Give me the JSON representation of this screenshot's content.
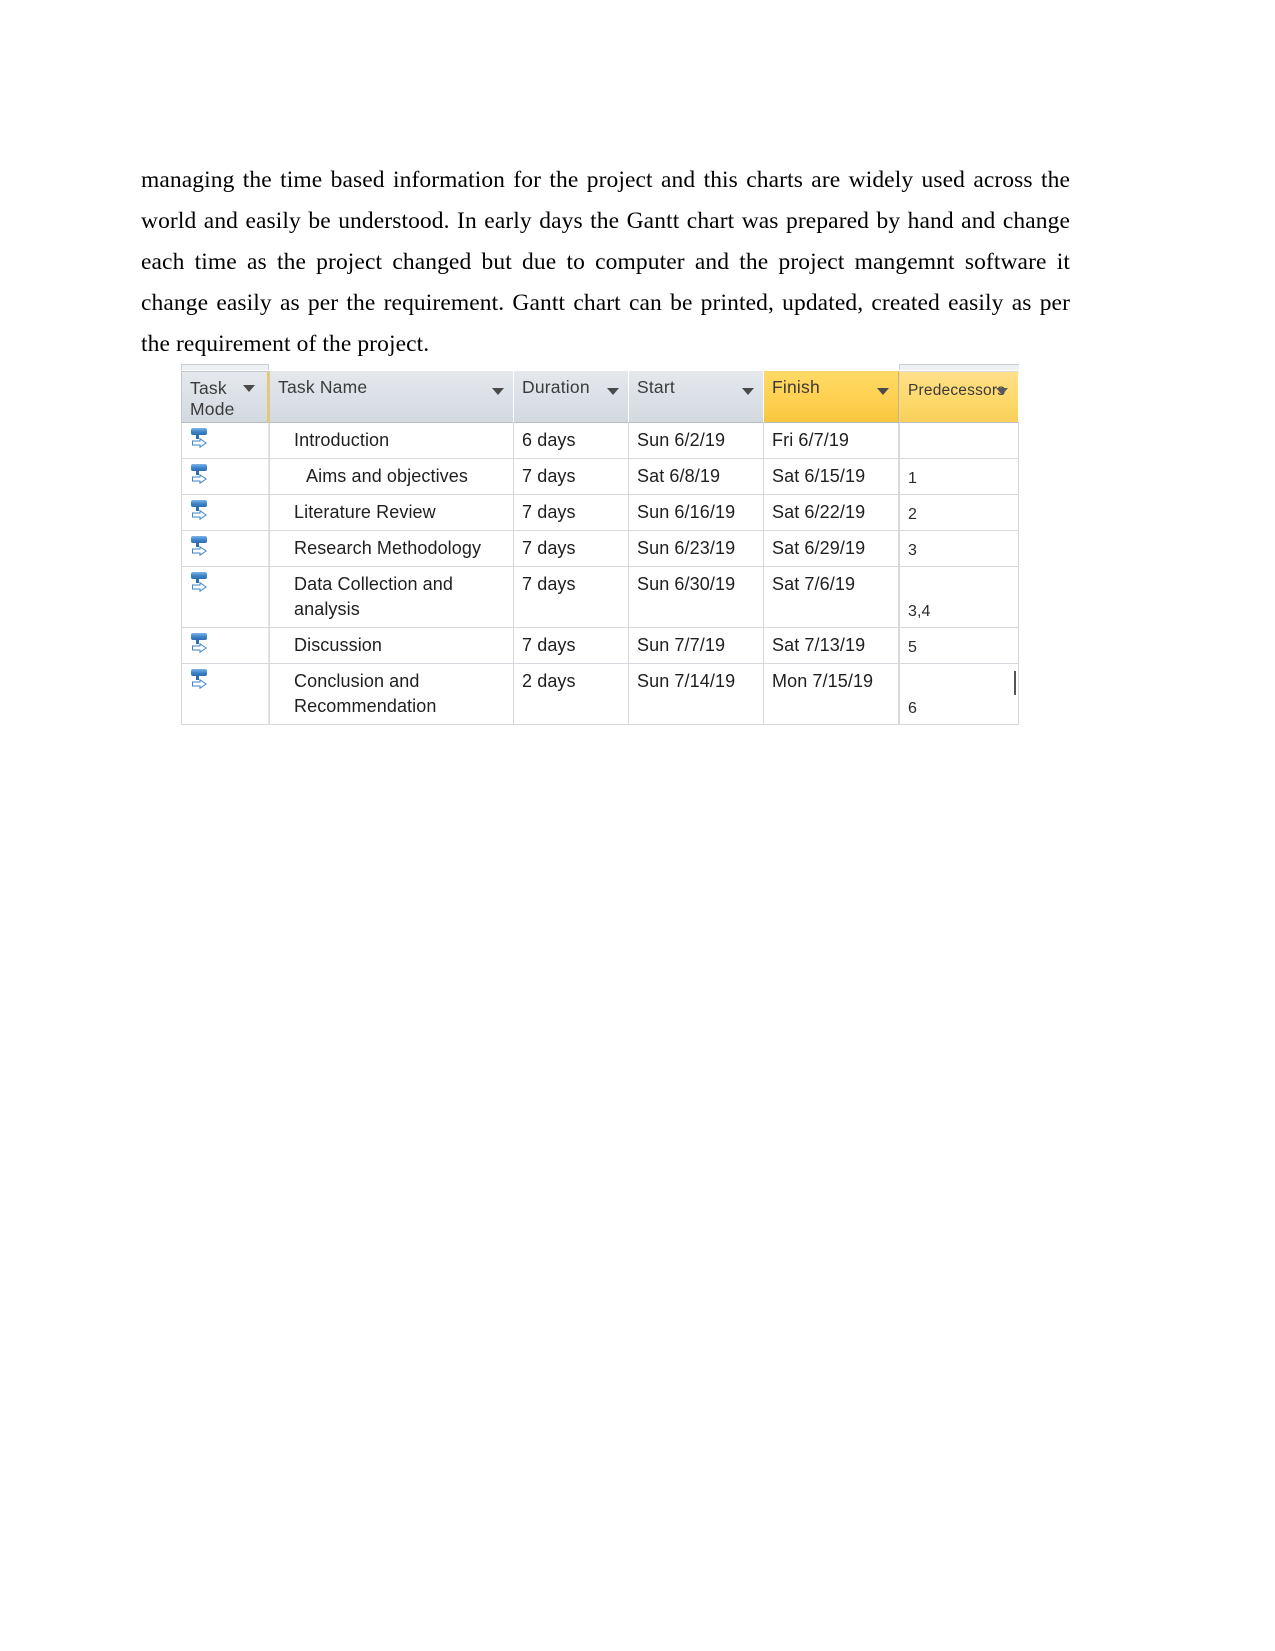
{
  "document": {
    "paragraph": "managing the time based information for the project and this charts are widely used across the world and easily be understood. In early days the Gantt chart was prepared by hand and change each time as the project changed but due to computer and the project mangemnt software it change easily as per the requirement.  Gantt chart can be printed, updated, created easily as per the requirement of the project."
  },
  "project_table": {
    "headers": {
      "task_mode": "Task Mode",
      "task_mode_line1": "Task",
      "task_mode_line2": "Mode",
      "task_name": "Task Name",
      "duration": "Duration",
      "start": "Start",
      "finish": "Finish",
      "predecessors": "Predecessors"
    },
    "colors": {
      "header_background": "#dde2e8",
      "highlight_yellow": "#ffd050",
      "predecessors_yellow": "#fdd869",
      "icon_blue": "#3d82c9",
      "grid_line": "#d5d8dc"
    },
    "rows": [
      {
        "mode_icon": "manually-scheduled-icon",
        "task_name": "Introduction",
        "indent": false,
        "duration": "6 days",
        "start": "Sun 6/2/19",
        "finish": "Fri 6/7/19",
        "predecessors": ""
      },
      {
        "mode_icon": "manually-scheduled-icon",
        "task_name": "Aims and objectives",
        "indent": true,
        "duration": "7 days",
        "start": "Sat 6/8/19",
        "finish": "Sat 6/15/19",
        "predecessors": "1"
      },
      {
        "mode_icon": "manually-scheduled-icon",
        "task_name": "Literature Review",
        "indent": false,
        "duration": "7 days",
        "start": "Sun 6/16/19",
        "finish": "Sat 6/22/19",
        "predecessors": "2"
      },
      {
        "mode_icon": "manually-scheduled-icon",
        "task_name": "Research Methodology",
        "indent": false,
        "duration": "7 days",
        "start": "Sun 6/23/19",
        "finish": "Sat 6/29/19",
        "predecessors": "3"
      },
      {
        "mode_icon": "manually-scheduled-icon",
        "task_name": "Data Collection and analysis",
        "indent": false,
        "duration": "7 days",
        "start": "Sun 6/30/19",
        "finish": "Sat 7/6/19",
        "predecessors": "3,4"
      },
      {
        "mode_icon": "manually-scheduled-icon",
        "task_name": "Discussion",
        "indent": false,
        "duration": "7 days",
        "start": "Sun 7/7/19",
        "finish": "Sat 7/13/19",
        "predecessors": "5"
      },
      {
        "mode_icon": "manually-scheduled-icon",
        "task_name": "Conclusion and Recommendation",
        "indent": false,
        "duration": "2 days",
        "start": "Sun 7/14/19",
        "finish": "Mon 7/15/19",
        "predecessors": "6"
      }
    ]
  }
}
